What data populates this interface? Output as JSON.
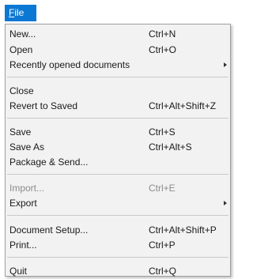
{
  "menubar": {
    "file_mnemonic": "F",
    "file_rest": "ile"
  },
  "menu": {
    "items": [
      {
        "label": "New...",
        "shortcut": "Ctrl+N"
      },
      {
        "label": "Open",
        "shortcut": "Ctrl+O"
      },
      {
        "label": "Recently opened documents",
        "shortcut": ""
      },
      {
        "label": "Close",
        "shortcut": ""
      },
      {
        "label": "Revert to Saved",
        "shortcut": "Ctrl+Alt+Shift+Z"
      },
      {
        "label": "Save",
        "shortcut": "Ctrl+S"
      },
      {
        "label": "Save As",
        "shortcut": "Ctrl+Alt+S"
      },
      {
        "label": "Package & Send...",
        "shortcut": ""
      },
      {
        "label": "Import...",
        "shortcut": "Ctrl+E"
      },
      {
        "label": "Export",
        "shortcut": ""
      },
      {
        "label": "Document Setup...",
        "shortcut": "Ctrl+Alt+Shift+P"
      },
      {
        "label": "Print...",
        "shortcut": "Ctrl+P"
      },
      {
        "label": "Quit",
        "shortcut": "Ctrl+Q"
      }
    ]
  },
  "colors": {
    "menubar_highlight": "#0b78d4",
    "menu_background": "#f2f2f2",
    "disabled_text": "#8c8c8c"
  }
}
